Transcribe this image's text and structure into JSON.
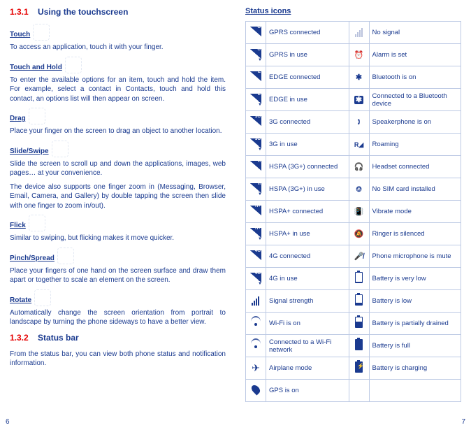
{
  "left": {
    "sec131_num": "1.3.1",
    "sec131_title": "Using the touchscreen",
    "touch_h": "Touch",
    "touch_p": "To access an application, touch it with your finger.",
    "hold_h": "Touch and Hold",
    "hold_p": "To enter the available options for an item, touch and hold the item. For example, select a contact in Contacts, touch and hold this contact, an options list will then appear on screen.",
    "drag_h": "Drag",
    "drag_p": "Place your finger on the screen to drag an object to another location.",
    "slide_h": "Slide/Swipe",
    "slide_p1": "Slide the screen to scroll up and down the applications, images, web pages… at your convenience.",
    "slide_p2": "The device also supports one finger zoom in (Messaging, Browser, Email, Camera, and Gallery) by double tapping the screen then slide with one finger to zoom in/out).",
    "flick_h": "Flick",
    "flick_p": "Similar to swiping, but flicking makes it move quicker.",
    "pinch_h": "Pinch/Spread",
    "pinch_p": "Place your fingers of one hand on the screen surface and draw them apart or together to scale an element on the screen.",
    "rotate_h": "Rotate",
    "rotate_p": "Automatically change the screen orientation from portrait to landscape by turning the phone sideways to have a better view.",
    "sec132_num": "1.3.2",
    "sec132_title": "Status bar",
    "sec132_p": "From the status bar, you can view both phone status and notification information."
  },
  "right": {
    "title": "Status icons",
    "rows": [
      [
        "G",
        "GPRS connected",
        "nosig",
        "No signal"
      ],
      [
        "G•",
        "GPRS in use",
        "alarm",
        "Alarm is set"
      ],
      [
        "E",
        "EDGE connected",
        "bt",
        "Bluetooth is on"
      ],
      [
        "E•",
        "EDGE in use",
        "btc",
        "Connected to a Bluetooth device"
      ],
      [
        "3G",
        "3G connected",
        "spk",
        "Speakerphone is on"
      ],
      [
        "3G•",
        "3G in use",
        "roam",
        "Roaming"
      ],
      [
        "H",
        "HSPA (3G+) connected",
        "head",
        "Headset connected"
      ],
      [
        "H•",
        "HSPA (3G+) in use",
        "nosim",
        "No SIM card installed"
      ],
      [
        "H+",
        "HSPA+ connected",
        "vib",
        "Vibrate mode"
      ],
      [
        "H+•",
        "HSPA+ in use",
        "sil",
        "Ringer is silenced"
      ],
      [
        "4G",
        "4G connected",
        "mic",
        "Phone microphone is mute"
      ],
      [
        "4G•",
        "4G in use",
        "bat1",
        "Battery is very low"
      ],
      [
        "sig",
        "Signal strength",
        "bat2",
        "Battery is low"
      ],
      [
        "wifi",
        "Wi-Fi is on",
        "bat3",
        "Battery is partially drained"
      ],
      [
        "wifi•",
        "Connected to a Wi-Fi network",
        "bat4",
        "Battery is full"
      ],
      [
        "plane",
        "Airplane mode",
        "batc",
        "Battery is charging"
      ],
      [
        "gps",
        "GPS is on",
        "",
        ""
      ]
    ]
  },
  "page_left": "6",
  "page_right": "7"
}
